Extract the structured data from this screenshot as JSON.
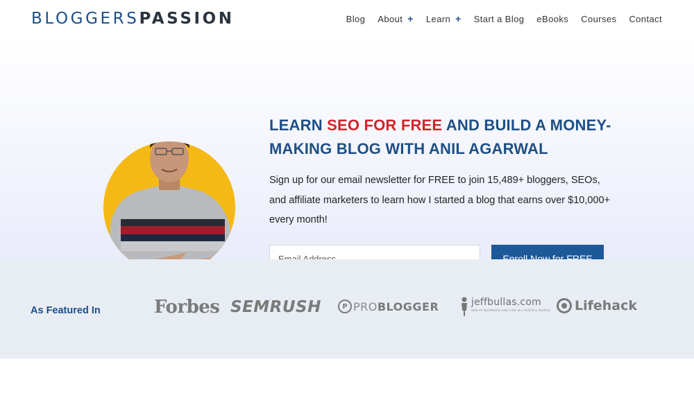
{
  "header": {
    "logo_part1": "BLOGGERS",
    "logo_part2": "PASSION",
    "nav": [
      {
        "label": "Blog",
        "expandable": false
      },
      {
        "label": "About",
        "expandable": true,
        "plus": "+"
      },
      {
        "label": "Learn",
        "expandable": true,
        "plus": "+"
      },
      {
        "label": "Start a Blog",
        "expandable": false
      },
      {
        "label": "eBooks",
        "expandable": false
      },
      {
        "label": "Courses",
        "expandable": false
      },
      {
        "label": "Contact",
        "expandable": false
      }
    ]
  },
  "hero": {
    "headline_part1": "LEARN ",
    "headline_highlight": "SEO FOR FREE",
    "headline_part2": " AND BUILD A MONEY-MAKING BLOG WITH ANIL AGARWAL",
    "lead": "Sign up for our email newsletter for FREE to join 15,489+ bloggers, SEOs, and affiliate marketers to learn how I started a blog that earns over $10,000+ every month!",
    "email_placeholder": "Email Address",
    "email_value": "",
    "cta_label": "Enroll Now for FREE",
    "portrait_icon": "person-photo"
  },
  "featured": {
    "label": "As Featured In",
    "logos": {
      "forbes": "Forbes",
      "semrush": "SEMRUSH",
      "problogger_icon": "P",
      "problogger_part1": "PRO",
      "problogger_part2": "BLOGGER",
      "jeffbullas": "jeffbullas.com",
      "jeffbullas_sub": "WIN AT BUSINESS AND LIFE IN A DIGITAL WORLD",
      "lifehack": "Lifehack"
    }
  },
  "colors": {
    "brand_blue": "#1d4f86",
    "highlight_red": "#d2232a",
    "button_blue": "#1d5898",
    "portrait_bg": "#f5b915",
    "featured_bg": "#e8edf4"
  }
}
